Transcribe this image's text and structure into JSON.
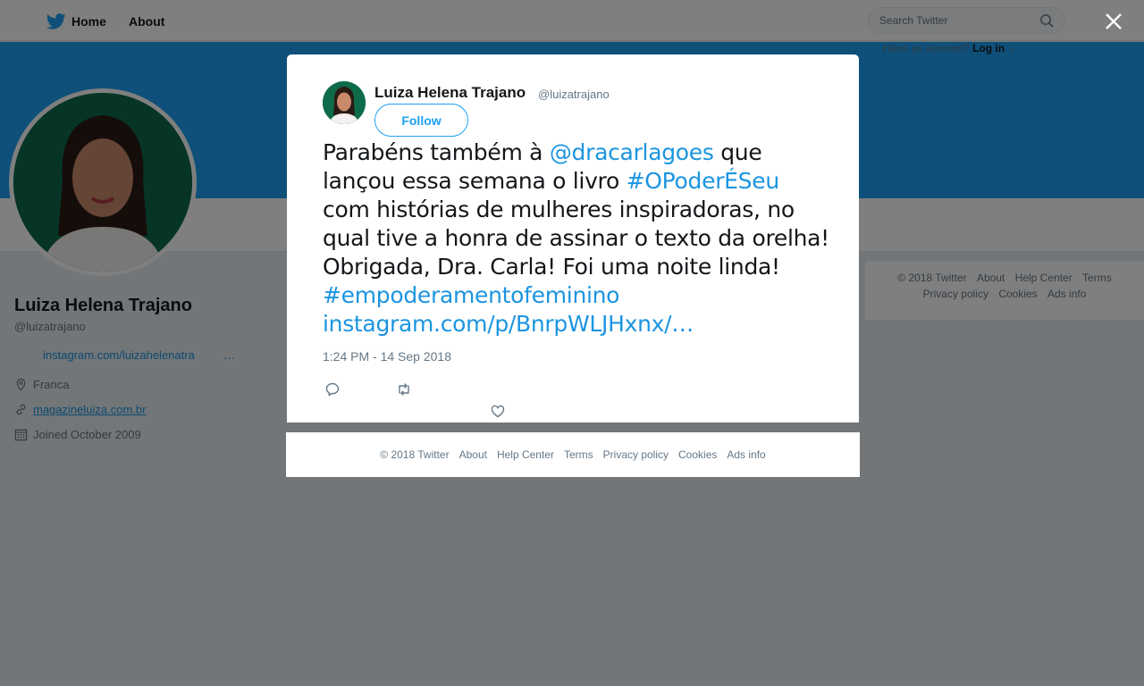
{
  "topnav": {
    "home_label": "Home",
    "about_label": "About",
    "search_placeholder": "Search Twitter",
    "have_account_text": "Have an account?",
    "login_label": "Log in"
  },
  "profile": {
    "name": "Luiza Helena Trajano",
    "handle": "@luizatrajano",
    "bio_link": "instagram.com/luizahelenatra",
    "bio_ellipsis": "…",
    "location": "Franca",
    "website": "magazineluiza.com.br",
    "joined": "Joined October 2009"
  },
  "side_footer": {
    "line1": [
      "© 2018 Twitter",
      "About",
      "Help Center",
      "Terms"
    ],
    "line2": [
      "Privacy policy",
      "Cookies",
      "Ads info"
    ]
  },
  "tweet": {
    "author_name": "Luiza Helena Trajano",
    "author_handle": "@luizatrajano",
    "follow_label": "Follow",
    "text_parts": [
      "Parabéns também à ",
      "@dracarlagoes",
      " que lançou essa semana o livro ",
      "#OPoderÉSeu",
      " com histórias de mulheres inspiradoras, no qual tive a honra de assinar o texto da orelha! Obrigada, Dra. Carla! Foi uma noite linda! ",
      "#empoderamentofeminino",
      " ",
      "instagram.com/p/BnrpWLJHxnx/…"
    ],
    "timestamp": "1:24 PM - 14 Sep 2018",
    "actions": [
      "reply-icon",
      "retweet-icon",
      "like-icon"
    ]
  },
  "modal_footer": [
    "© 2018 Twitter",
    "About",
    "Help Center",
    "Terms",
    "Privacy policy",
    "Cookies",
    "Ads info"
  ],
  "colors": {
    "twitter_blue": "#1da1f2",
    "link_blue": "#1b95e0",
    "avatar_green": "#0e6b4a"
  }
}
